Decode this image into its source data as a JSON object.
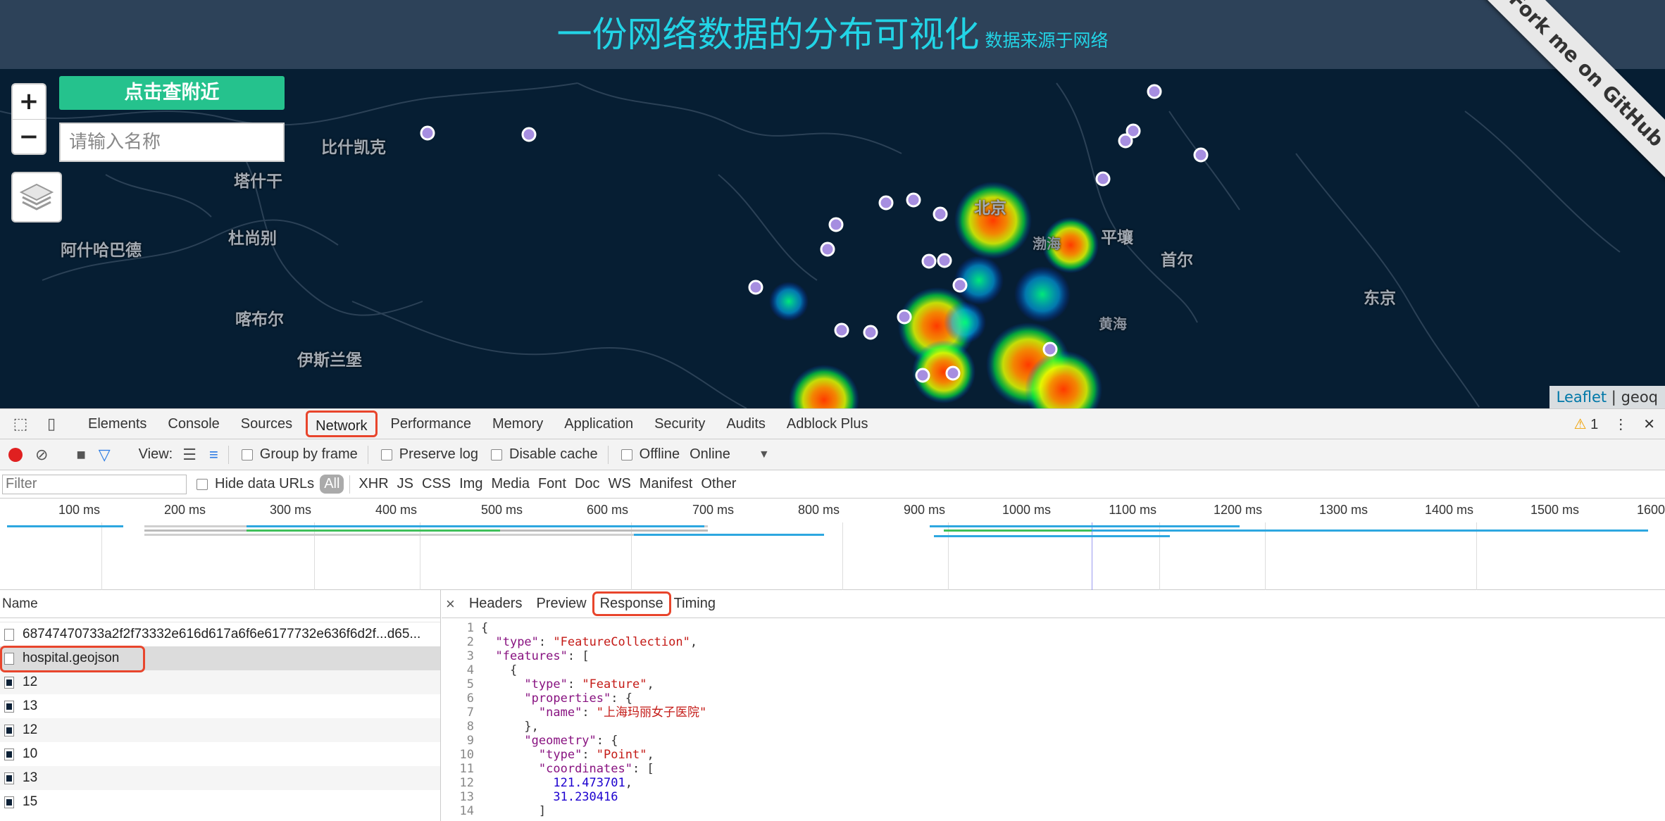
{
  "header": {
    "title": "一份网络数据的分布可视化",
    "subtitle": "数据来源于网络"
  },
  "ribbon": {
    "label": "Fork me on GitHub"
  },
  "map": {
    "zoom_in": "+",
    "zoom_out": "−",
    "near_button": "点击查附近",
    "search_placeholder": "请输入名称",
    "attribution_link": "Leaflet",
    "attribution_sep": " | ",
    "attribution_text": "geoq",
    "labels": [
      "比什凯克",
      "塔什干",
      "杜尚别",
      "阿什哈巴德",
      "喀布尔",
      "伊斯兰堡",
      "北京",
      "渤海",
      "平壤",
      "首尔",
      "黄海",
      "东京"
    ]
  },
  "devtools": {
    "tabs": [
      "Elements",
      "Console",
      "Sources",
      "Network",
      "Performance",
      "Memory",
      "Application",
      "Security",
      "Audits",
      "Adblock Plus"
    ],
    "active_tab": "Network",
    "warning_count": "1",
    "toolbar": {
      "view_label": "View:",
      "group_by_frame": "Group by frame",
      "preserve_log": "Preserve log",
      "disable_cache": "Disable cache",
      "offline": "Offline",
      "throttle": "Online"
    },
    "filter": {
      "placeholder": "Filter",
      "hide_data_urls": "Hide data URLs",
      "types": [
        "All",
        "XHR",
        "JS",
        "CSS",
        "Img",
        "Media",
        "Font",
        "Doc",
        "WS",
        "Manifest",
        "Other"
      ]
    },
    "timeline_ticks": [
      "100 ms",
      "200 ms",
      "300 ms",
      "400 ms",
      "500 ms",
      "600 ms",
      "700 ms",
      "800 ms",
      "900 ms",
      "1000 ms",
      "1100 ms",
      "1200 ms",
      "1300 ms",
      "1400 ms",
      "1500 ms",
      "1600"
    ],
    "requests": {
      "header": "Name",
      "rows": [
        "68747470733a2f2f73332e616d617a6f6e6177732e636f6d2f...d65...",
        "hospital.geojson",
        "12",
        "13",
        "12",
        "10",
        "13",
        "15"
      ]
    },
    "detail": {
      "close": "×",
      "tabs": [
        "Headers",
        "Preview",
        "Response",
        "Timing"
      ],
      "active_tab": "Response",
      "code_lines": [
        "{",
        "  \"type\": \"FeatureCollection\",",
        "  \"features\": [",
        "    {",
        "      \"type\": \"Feature\",",
        "      \"properties\": {",
        "        \"name\": \"上海玛丽女子医院\"",
        "      },",
        "      \"geometry\": {",
        "        \"type\": \"Point\",",
        "        \"coordinates\": [",
        "          121.473701,",
        "          31.230416",
        "        ]"
      ]
    }
  },
  "colors": {
    "header_bg": "#2d4259",
    "title": "#22d4e6",
    "map_bg": "#061e33",
    "near_button": "#25c28d",
    "highlight": "#e8452c"
  }
}
